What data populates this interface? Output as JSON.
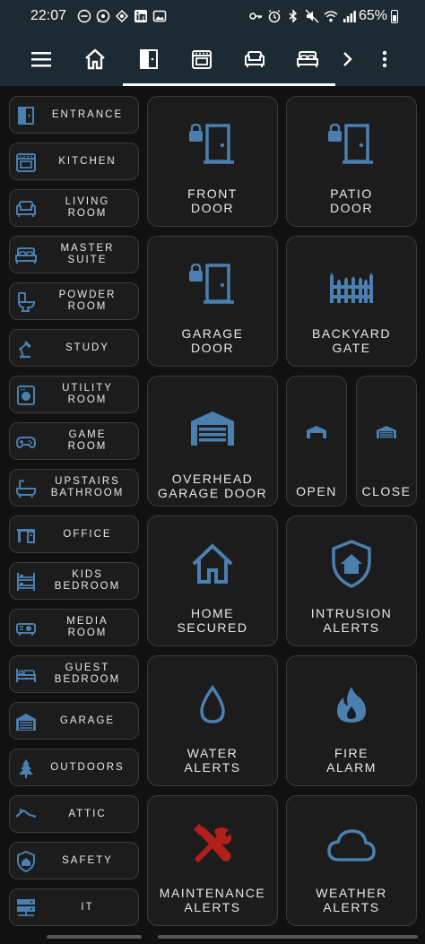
{
  "status_bar": {
    "time": "22:07",
    "battery_percent": "65%",
    "left_icons": [
      "do-not-disturb-icon",
      "whatsapp-icon",
      "slack-icon",
      "linkedin-icon",
      "image-icon"
    ],
    "right_icons": [
      "key-icon",
      "alarm-icon",
      "bluetooth-icon",
      "mute-icon",
      "wifi-icon",
      "signal-icon"
    ]
  },
  "toolbar": {
    "tabs": [
      "home-icon",
      "door-icon",
      "stove-icon",
      "sofa-icon",
      "bed-icon"
    ],
    "active_tab": "door-icon"
  },
  "sidebar": {
    "items": [
      {
        "label": "ENTRANCE",
        "icon": "door-icon"
      },
      {
        "label": "KITCHEN",
        "icon": "stove-icon"
      },
      {
        "label": "LIVING\nROOM",
        "icon": "sofa-icon"
      },
      {
        "label": "MASTER\nSUITE",
        "icon": "bed-icon"
      },
      {
        "label": "POWDER\nROOM",
        "icon": "toilet-icon"
      },
      {
        "label": "STUDY",
        "icon": "desk-lamp-icon"
      },
      {
        "label": "UTILITY\nROOM",
        "icon": "washing-machine-icon"
      },
      {
        "label": "GAME\nROOM",
        "icon": "gamepad-icon"
      },
      {
        "label": "UPSTAIRS\nBATHROOM",
        "icon": "bathtub-icon"
      },
      {
        "label": "OFFICE",
        "icon": "office-desk-icon"
      },
      {
        "label": "KIDS\nBEDROOM",
        "icon": "bunk-bed-icon"
      },
      {
        "label": "MEDIA\nROOM",
        "icon": "projector-icon"
      },
      {
        "label": "GUEST\nBEDROOM",
        "icon": "guest-bed-icon"
      },
      {
        "label": "GARAGE",
        "icon": "garage-icon"
      },
      {
        "label": "OUTDOORS",
        "icon": "tree-icon"
      },
      {
        "label": "ATTIC",
        "icon": "roof-icon"
      },
      {
        "label": "SAFETY",
        "icon": "shield-home-icon"
      },
      {
        "label": "IT",
        "icon": "server-icon"
      }
    ]
  },
  "tiles": {
    "front_door": {
      "label": "FRONT\nDOOR",
      "icon": "door-lock-icon"
    },
    "patio_door": {
      "label": "PATIO\nDOOR",
      "icon": "door-lock-icon"
    },
    "garage_door": {
      "label": "GARAGE\nDOOR",
      "icon": "door-lock-icon"
    },
    "backyard_gate": {
      "label": "BACKYARD\nGATE",
      "icon": "gate-icon"
    },
    "overhead_garage": {
      "label": "OVERHEAD\nGARAGE DOOR",
      "icon": "garage-icon"
    },
    "open": {
      "label": "OPEN",
      "icon": "garage-open-icon"
    },
    "close": {
      "label": "CLOSE",
      "icon": "garage-close-icon"
    },
    "home_secured": {
      "label": "HOME\nSECURED",
      "icon": "home-outline-icon"
    },
    "intrusion_alerts": {
      "label": "INTRUSION\nALERTS",
      "icon": "shield-home-icon"
    },
    "water_alerts": {
      "label": "WATER\nALERTS",
      "icon": "water-drop-icon"
    },
    "fire_alarm": {
      "label": "FIRE\nALARM",
      "icon": "fire-icon"
    },
    "maintenance_alerts": {
      "label": "MAINTENANCE\nALERTS",
      "icon": "tools-icon"
    },
    "weather_alerts": {
      "label": "WEATHER\nALERTS",
      "icon": "cloud-icon"
    }
  },
  "colors": {
    "icon_blue": "#4a7fb0",
    "icon_red": "#b3201a",
    "tile_bg": "#1c1c1c",
    "toolbar_bg": "#1b2a33",
    "page_bg": "#111111"
  }
}
